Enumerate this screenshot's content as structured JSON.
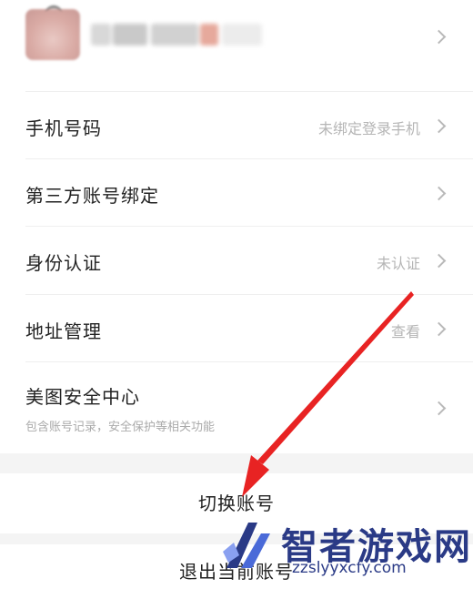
{
  "profile": {
    "name_blurred": true
  },
  "rows": [
    {
      "label": "手机号码",
      "value": "未绑定登录手机"
    },
    {
      "label": "第三方账号绑定",
      "value": ""
    },
    {
      "label": "身份认证",
      "value": "未认证"
    },
    {
      "label": "地址管理",
      "value": "查看"
    },
    {
      "label": "美图安全中心",
      "sub": "包含账号记录，安全保护等相关功能",
      "value": ""
    }
  ],
  "actions": {
    "switch_account": "切换账号",
    "logout": "退出当前账号"
  },
  "watermark": {
    "title": "智者游戏网",
    "url": "zzslyyxcfy.com"
  },
  "colors": {
    "annotation_arrow": "#e82323",
    "watermark": "#2a3a86",
    "section_gap": "#f4f4f4"
  }
}
